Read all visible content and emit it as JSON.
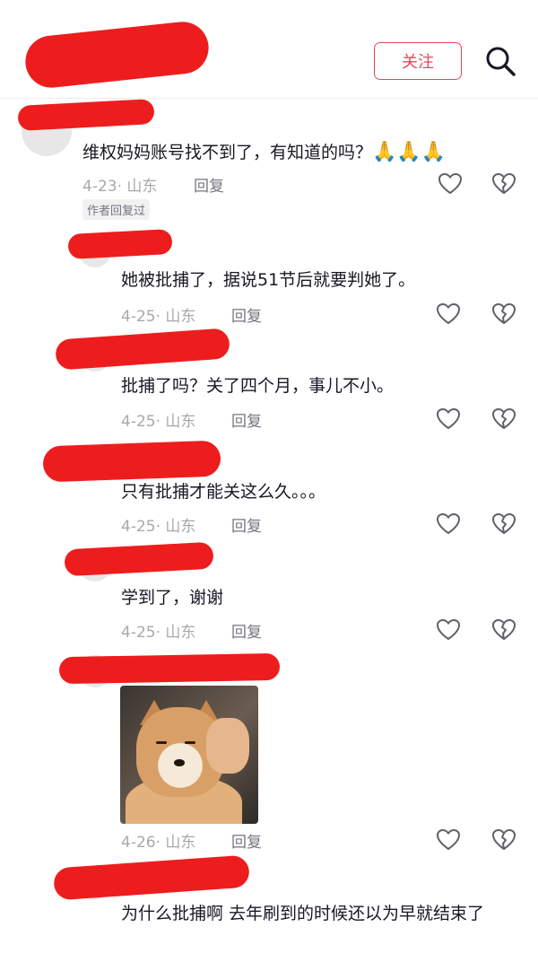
{
  "header": {
    "follow_label": "关注",
    "back_icon": "chevron-left-icon",
    "search_icon": "search-icon",
    "accent_color": "#e8465a",
    "redaction_color": "#ee1d1d"
  },
  "comments": [
    {
      "text": "维权妈妈账号找不到了，有知道的吗？",
      "emoji": "🙏🙏🙏",
      "date": "4-23",
      "location": "山东",
      "reply_label": "回复",
      "author_tag": "作者回复过"
    },
    {
      "text": "她被批捕了，据说51节后就要判她了。",
      "date": "4-25",
      "location": "山东",
      "reply_label": "回复"
    },
    {
      "text": "批捕了吗？关了四个月，事儿不小。",
      "date": "4-25",
      "location": "山东",
      "reply_label": "回复"
    },
    {
      "text": "只有批捕才能关这么久。。。",
      "date": "4-25",
      "location": "山东",
      "reply_label": "回复"
    },
    {
      "text": "学到了，谢谢",
      "date": "4-25",
      "location": "山东",
      "reply_label": "回复"
    },
    {
      "text": "",
      "date": "4-26",
      "location": "山东",
      "reply_label": "回复",
      "image": "shiba-dog-photo"
    },
    {
      "text": "为什么批捕啊 去年刷到的时候还以为早就结束了",
      "date": "",
      "location": "",
      "reply_label": ""
    }
  ]
}
